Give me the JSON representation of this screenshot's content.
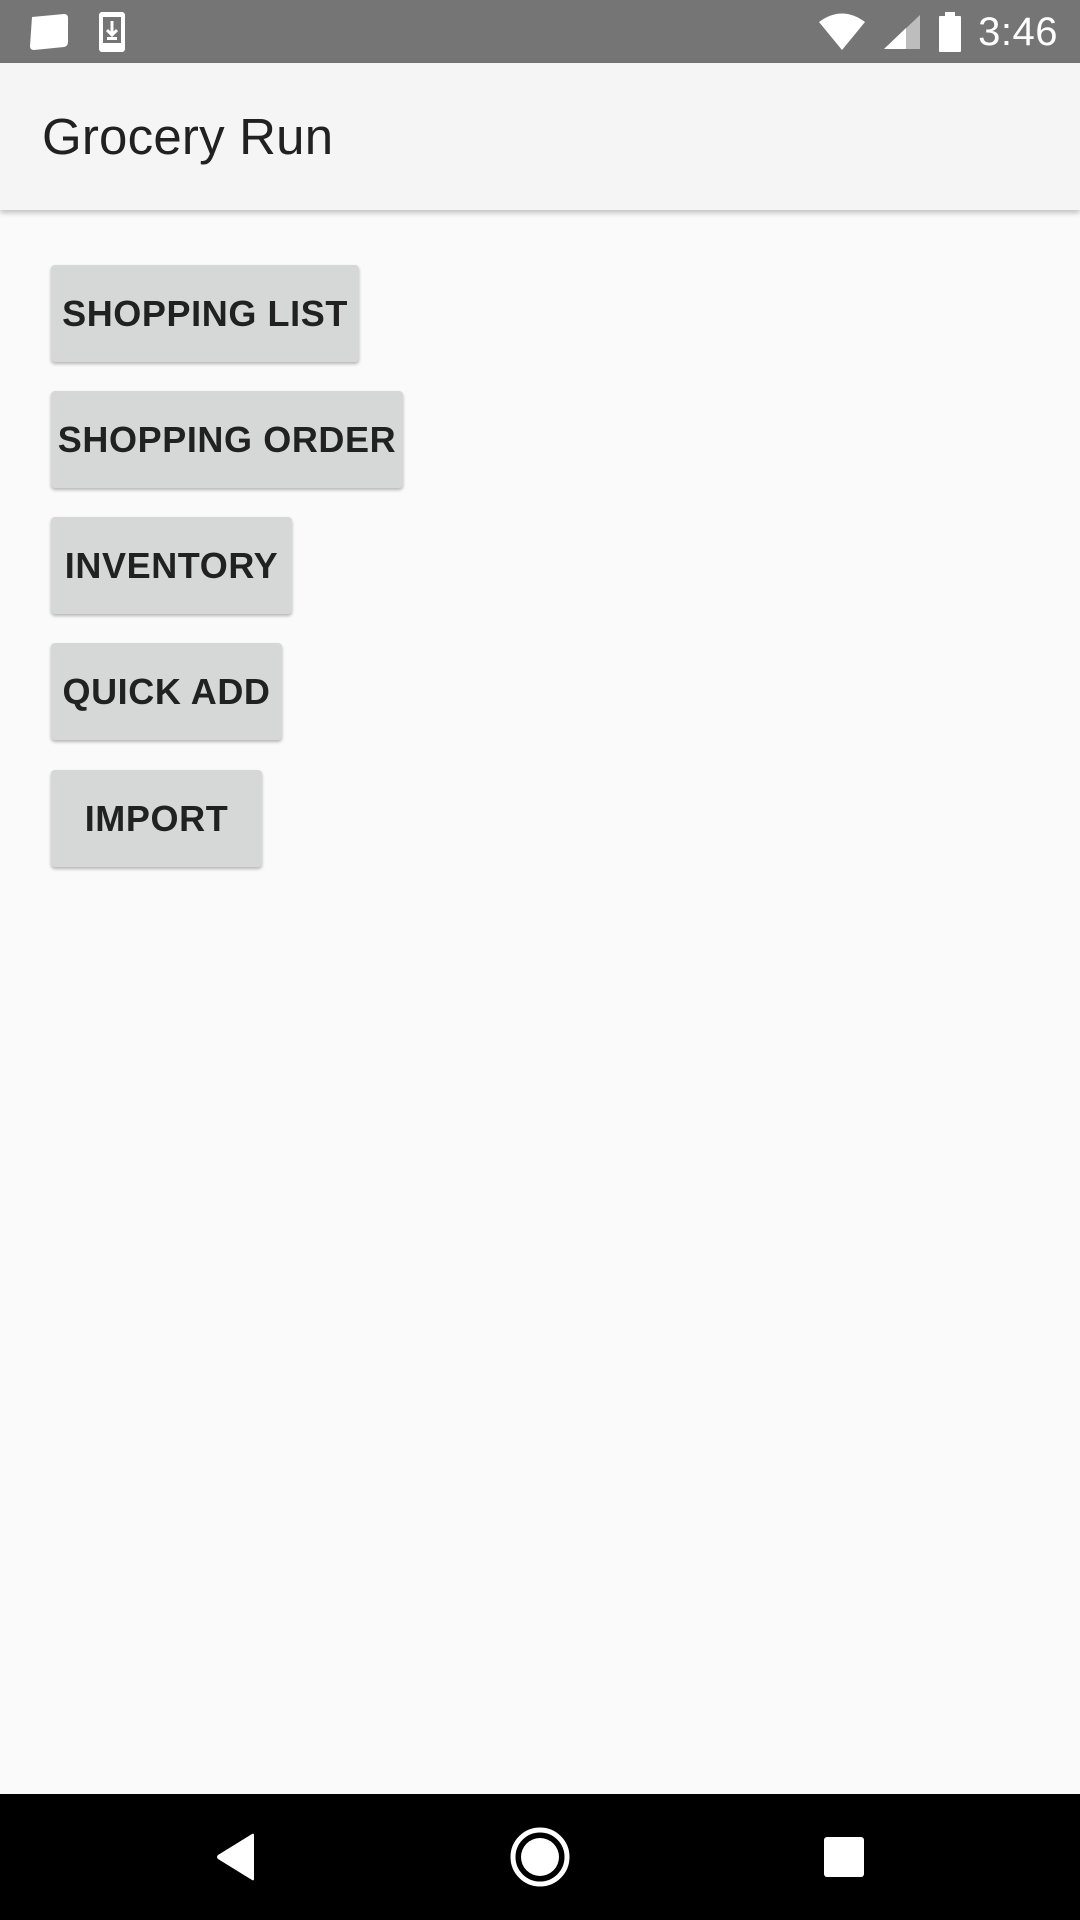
{
  "status_bar": {
    "time": "3:46",
    "left_icons": [
      "notification-card-icon",
      "download-icon"
    ],
    "right_icons": [
      "wifi-icon",
      "cell-signal-icon",
      "battery-icon"
    ]
  },
  "app_bar": {
    "title": "Grocery Run"
  },
  "buttons": [
    {
      "id": "shopping-list",
      "label": "SHOPPING LIST"
    },
    {
      "id": "shopping-order",
      "label": "SHOPPING ORDER"
    },
    {
      "id": "inventory",
      "label": "INVENTORY"
    },
    {
      "id": "quick-add",
      "label": "QUICK ADD"
    },
    {
      "id": "import",
      "label": "IMPORT"
    }
  ],
  "nav_bar": {
    "icons": [
      "back-icon",
      "home-icon",
      "recents-icon"
    ]
  },
  "colors": {
    "status_bar": "#757575",
    "app_bar": "#f5f5f5",
    "background": "#fafafa",
    "button": "#d6d7d7",
    "nav_bar": "#000000"
  }
}
